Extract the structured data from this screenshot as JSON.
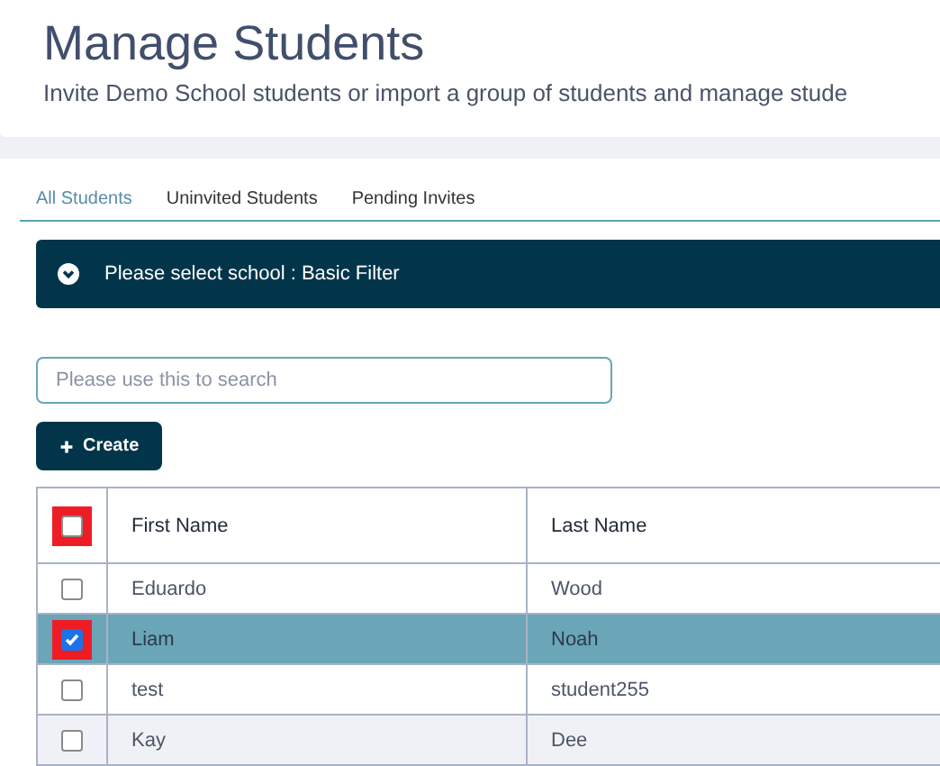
{
  "header": {
    "title": "Manage Students",
    "subtitle": "Invite Demo School students or import a group of students and manage stude"
  },
  "tabs": [
    {
      "label": "All Students",
      "selected": true
    },
    {
      "label": "Uninvited Students",
      "selected": false
    },
    {
      "label": "Pending Invites",
      "selected": false
    }
  ],
  "filter_bar": {
    "label": "Please select school : Basic Filter",
    "expanded": false
  },
  "search": {
    "placeholder": "Please use this to search"
  },
  "create_button": {
    "label": "Create"
  },
  "table": {
    "select_all": {
      "checked": false,
      "highlighted": true
    },
    "columns": [
      "First Name",
      "Last Name"
    ],
    "rows": [
      {
        "cells": [
          "Eduardo",
          "Wood"
        ],
        "selected": false,
        "highlighted": false,
        "hovered": false
      },
      {
        "cells": [
          "Liam",
          "Noah"
        ],
        "selected": true,
        "highlighted": true,
        "hovered": false
      },
      {
        "cells": [
          "test",
          "student255"
        ],
        "selected": false,
        "highlighted": false,
        "hovered": false
      },
      {
        "cells": [
          "Kay",
          "Dee"
        ],
        "selected": false,
        "highlighted": false,
        "hovered": true
      }
    ]
  }
}
